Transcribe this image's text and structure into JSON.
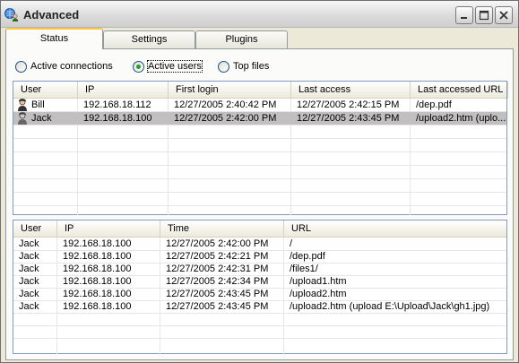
{
  "window": {
    "title": "Advanced",
    "app_icon": "globe-user-icon"
  },
  "titlebar_buttons": {
    "minimize_icon": "minimize-icon",
    "maximize_icon": "maximize-icon",
    "close_icon": "close-icon"
  },
  "tabs": [
    {
      "label": "Status",
      "active": true
    },
    {
      "label": "Settings",
      "active": false
    },
    {
      "label": "Plugins",
      "active": false
    }
  ],
  "view_options": [
    {
      "label": "Active connections",
      "selected": false
    },
    {
      "label": "Active users",
      "selected": true
    },
    {
      "label": "Top files",
      "selected": false
    }
  ],
  "users_table": {
    "columns": [
      "User",
      "IP",
      "First login",
      "Last access",
      "Last accessed URL"
    ],
    "rows": [
      {
        "user": "Bill",
        "ip": "192.168.18.112",
        "first_login": "12/27/2005 2:40:42 PM",
        "last_access": "12/27/2005 2:42:15 PM",
        "url": "/dep.pdf",
        "selected": false
      },
      {
        "user": "Jack",
        "ip": "192.168.18.100",
        "first_login": "12/27/2005 2:42:00 PM",
        "last_access": "12/27/2005 2:43:45 PM",
        "url": "/upload2.htm (uplo...",
        "selected": true
      }
    ]
  },
  "log_table": {
    "columns": [
      "User",
      "IP",
      "Time",
      "URL"
    ],
    "rows": [
      {
        "user": "Jack",
        "ip": "192.168.18.100",
        "time": "12/27/2005 2:42:00 PM",
        "url": "/"
      },
      {
        "user": "Jack",
        "ip": "192.168.18.100",
        "time": "12/27/2005 2:42:21 PM",
        "url": "/dep.pdf"
      },
      {
        "user": "Jack",
        "ip": "192.168.18.100",
        "time": "12/27/2005 2:42:31 PM",
        "url": "/files1/"
      },
      {
        "user": "Jack",
        "ip": "192.168.18.100",
        "time": "12/27/2005 2:42:34 PM",
        "url": "/upload1.htm"
      },
      {
        "user": "Jack",
        "ip": "192.168.18.100",
        "time": "12/27/2005 2:43:45 PM",
        "url": "/upload2.htm"
      },
      {
        "user": "Jack",
        "ip": "192.168.18.100",
        "time": "12/27/2005 2:43:45 PM",
        "url": "/upload2.htm (upload E:\\Upload\\Jack\\gh1.jpg)"
      }
    ]
  },
  "colors": {
    "selection": "#c1bfbf",
    "tab_highlight": "#ffc83c",
    "radio_dot": "#21a121"
  }
}
